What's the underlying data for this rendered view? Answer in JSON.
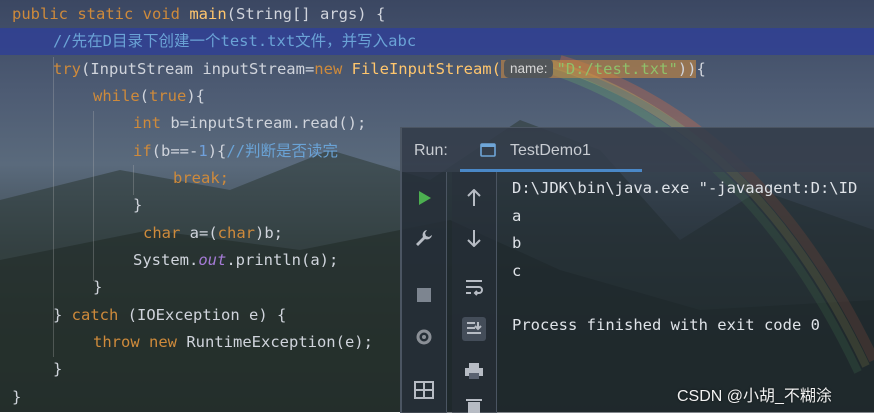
{
  "code": {
    "line1": {
      "kw": "public static void",
      "fn": "main",
      "rest": "(String[] args) {"
    },
    "line2": {
      "comment": "//先在D目录下创建一个test.txt文件，并写入abc"
    },
    "line3": {
      "kw1": "try",
      "p1": "(InputStream inputStream=",
      "kw2": "new",
      "fn": "FileInputStream(",
      "hint": "name:",
      "str": "\"D:/test.txt\"",
      "rest": "))",
      "brace": "{"
    },
    "line4": {
      "kw": "while",
      "p1": "(",
      "kw2": "true",
      "p2": "){"
    },
    "line5": {
      "kw": "int",
      "rest": "b=inputStream.read();"
    },
    "line6": {
      "kw": "if",
      "p1": "(b==-",
      "num": "1",
      "p2": "){",
      "comment": "//判断是否读完"
    },
    "line7": {
      "kw": "break;"
    },
    "line8": {
      "text": "}"
    },
    "line9": {
      "kw": "char",
      "p1": "a=(",
      "kw2": "char",
      "p2": ")b;"
    },
    "line10": {
      "p1": "System.",
      "field": "out",
      "p2": ".println(a);"
    },
    "line11": {
      "text": "}"
    },
    "line12": {
      "p1": "} ",
      "kw": "catch",
      "p2": " (IOException e) {"
    },
    "line13": {
      "kw": "throw new",
      "p1": " RuntimeException(e);"
    },
    "line14": {
      "text": "}"
    },
    "line15": {
      "text": "}"
    }
  },
  "run_panel": {
    "label": "Run:",
    "tab_label": "TestDemo1",
    "console_lines": [
      "D:\\JDK\\bin\\java.exe \"-javaagent:D:\\ID",
      "a",
      "b",
      "c",
      "",
      "Process finished with exit code 0"
    ]
  },
  "watermark": "CSDN @小胡_不糊涂",
  "colors": {
    "keyword": "#ce8a3b",
    "function": "#ffc66d",
    "string": "#8fc06a",
    "comment": "#6aa3d6",
    "highlight_line": "#304096",
    "tab_underline": "#4a88c7"
  }
}
